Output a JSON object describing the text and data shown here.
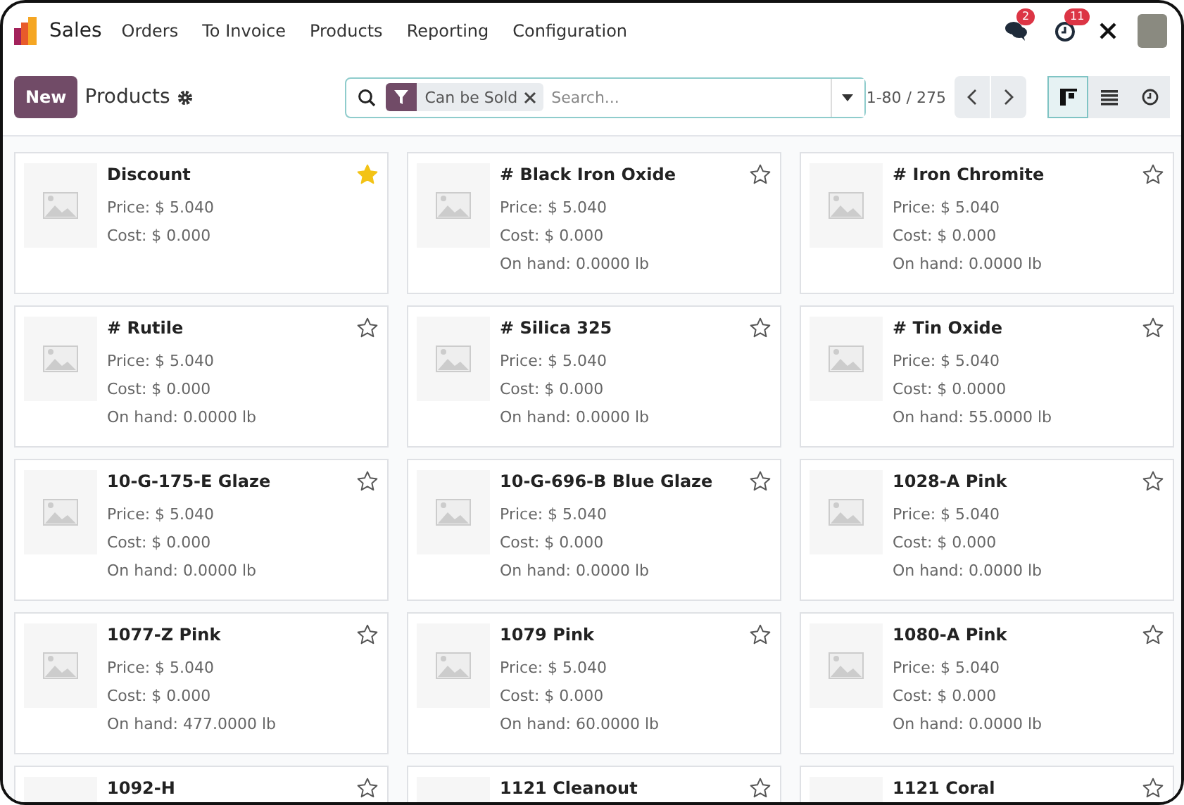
{
  "navbar": {
    "app": "Sales",
    "menu": [
      "Orders",
      "To Invoice",
      "Products",
      "Reporting",
      "Configuration"
    ],
    "messages_badge": "2",
    "activities_badge": "11"
  },
  "control_panel": {
    "new_button": "New",
    "title": "Products",
    "filter": "Can be Sold",
    "search_placeholder": "Search...",
    "pager": "1-80 / 275",
    "views": [
      {
        "kind": "kanban",
        "selected": true
      },
      {
        "kind": "list",
        "selected": false
      },
      {
        "kind": "activity",
        "selected": false
      }
    ]
  },
  "cards": [
    {
      "name": "Discount",
      "favorite": true,
      "lines": [
        "Price: $ 5.040",
        "Cost: $ 0.000"
      ]
    },
    {
      "name": "# Black Iron Oxide",
      "favorite": false,
      "lines": [
        "Price: $ 5.040",
        "Cost: $ 0.000",
        "On hand: 0.0000 lb"
      ]
    },
    {
      "name": "# Iron Chromite",
      "favorite": false,
      "lines": [
        "Price: $ 5.040",
        "Cost: $ 0.000",
        "On hand: 0.0000 lb"
      ]
    },
    {
      "name": "# Rutile",
      "favorite": false,
      "lines": [
        "Price: $ 5.040",
        "Cost: $ 0.000",
        "On hand: 0.0000 lb"
      ]
    },
    {
      "name": "# Silica 325",
      "favorite": false,
      "lines": [
        "Price: $ 5.040",
        "Cost: $ 0.000",
        "On hand: 0.0000 lb"
      ]
    },
    {
      "name": "# Tin Oxide",
      "favorite": false,
      "lines": [
        "Price: $ 5.040",
        "Cost: $ 0.0000",
        "On hand: 55.0000 lb"
      ]
    },
    {
      "name": "10-G-175-E Glaze",
      "favorite": false,
      "lines": [
        "Price: $ 5.040",
        "Cost: $ 0.000",
        "On hand: 0.0000 lb"
      ]
    },
    {
      "name": "10-G-696-B Blue Glaze",
      "favorite": false,
      "lines": [
        "Price: $ 5.040",
        "Cost: $ 0.000",
        "On hand: 0.0000 lb"
      ]
    },
    {
      "name": "1028-A Pink",
      "favorite": false,
      "lines": [
        "Price: $ 5.040",
        "Cost: $ 0.000",
        "On hand: 0.0000 lb"
      ]
    },
    {
      "name": "1077-Z Pink",
      "favorite": false,
      "lines": [
        "Price: $ 5.040",
        "Cost: $ 0.000",
        "On hand: 477.0000 lb"
      ]
    },
    {
      "name": "1079 Pink",
      "favorite": false,
      "lines": [
        "Price: $ 5.040",
        "Cost: $ 0.000",
        "On hand: 60.0000 lb"
      ]
    },
    {
      "name": "1080-A Pink",
      "favorite": false,
      "lines": [
        "Price: $ 5.040",
        "Cost: $ 0.000",
        "On hand: 0.0000 lb"
      ]
    },
    {
      "name": "1092-H",
      "favorite": false
    },
    {
      "name": "1121 Cleanout",
      "favorite": false
    },
    {
      "name": "1121 Coral",
      "favorite": false
    }
  ]
}
